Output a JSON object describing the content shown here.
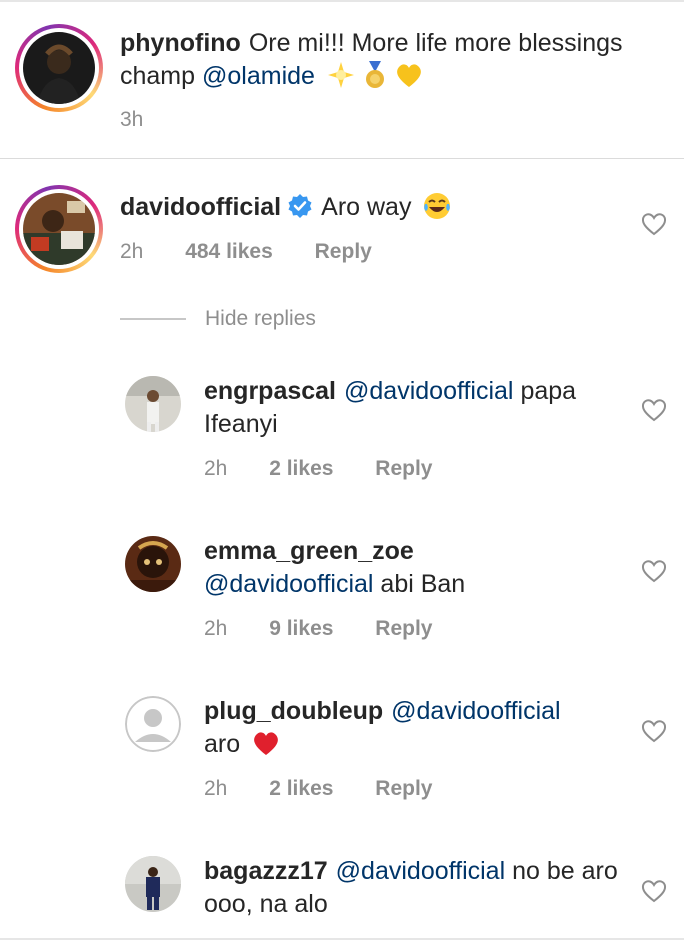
{
  "comments": [
    {
      "username": "phynofino",
      "text": "Ore mi!!! More life more blessings champ",
      "mention": "@olamide",
      "time": "3h"
    },
    {
      "username": "davidoofficial",
      "text": "Aro way",
      "time": "2h",
      "likes": "484 likes",
      "reply": "Reply",
      "verified": true
    }
  ],
  "hide_replies": "Hide replies",
  "replies": [
    {
      "username": "engrpascal",
      "mention": "@davidoofficial",
      "text": "papa Ifeanyi",
      "time": "2h",
      "likes": "2 likes",
      "reply": "Reply"
    },
    {
      "username": "emma_green_zoe",
      "mention": "@davidoofficial",
      "text": "abi Ban",
      "time": "2h",
      "likes": "9 likes",
      "reply": "Reply"
    },
    {
      "username": "plug_doubleup",
      "mention": "@davidoofficial",
      "text": "aro",
      "time": "2h",
      "likes": "2 likes",
      "reply": "Reply"
    },
    {
      "username": "bagazzz17",
      "mention": "@davidoofficial",
      "text": "no be aro ooo, na alo"
    }
  ],
  "colors": {
    "mention": "#003569",
    "meta": "#8e8e8e",
    "verified": "#3897f0"
  }
}
